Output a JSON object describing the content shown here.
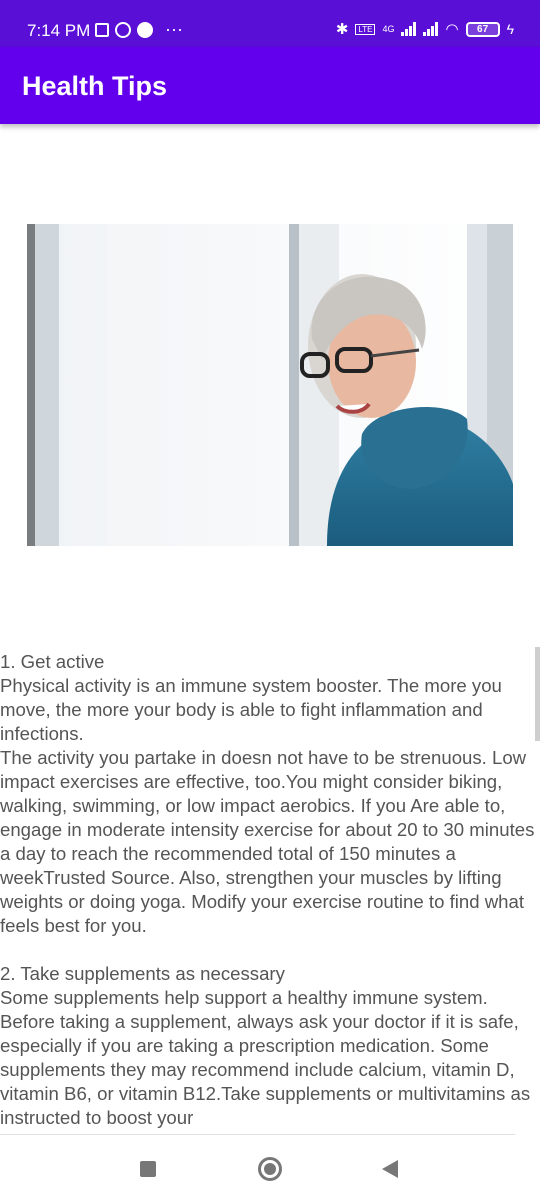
{
  "status_bar": {
    "time": "7:14 PM",
    "battery": "67",
    "network": "4G",
    "icons": [
      "document-icon",
      "whatsapp-icon",
      "app-icon",
      "more-dots-icon",
      "bluetooth-icon",
      "volte-icon",
      "signal-icon",
      "wifi-icon",
      "battery-icon",
      "charging-icon"
    ]
  },
  "app_bar": {
    "title": "Health Tips",
    "background": "#6200ee",
    "status_background": "#5a0fd6"
  },
  "hero_image": {
    "description_icon": "elderly-woman-photo"
  },
  "content": {
    "tips": [
      {
        "heading": "1. Get active",
        "body": " Physical activity is an immune system booster. The more you move, the more your body is able to fight inflammation and infections.\n The activity you partake in doesn not have to be strenuous. Low impact exercises are effective, too.You might consider biking, walking, swimming, or low impact aerobics. If you Are able to, engage in moderate intensity exercise for about 20 to 30 minutes a day to reach the recommended total of 150 minutes a weekTrusted Source. Also, strengthen your muscles by lifting weights or doing yoga. Modify your exercise routine to find what feels best for you."
      },
      {
        "heading": " 2. Take supplements as necessary",
        "body": " Some supplements help support a healthy immune system. Before taking a supplement, always ask your doctor if it is safe, especially if you are taking a prescription medication. Some supplements they may recommend include calcium, vitamin D, vitamin B6, or vitamin B12.Take supplements or multivitamins as instructed to boost your"
      }
    ]
  },
  "nav": {
    "icons": [
      "recent-apps-icon",
      "home-icon",
      "back-icon"
    ]
  }
}
